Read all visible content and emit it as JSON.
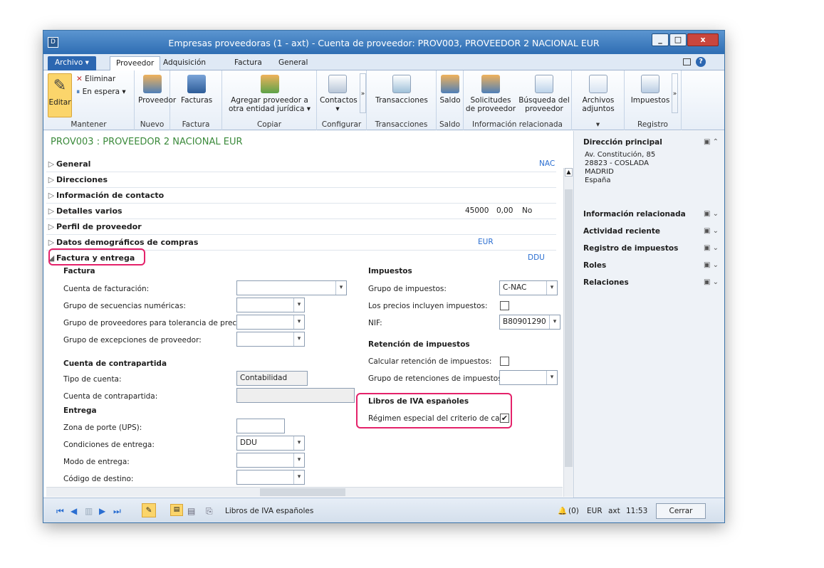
{
  "window": {
    "title": "Empresas proveedoras (1 - axt) - Cuenta de proveedor: PROV003, PROVEEDOR 2 NACIONAL EUR",
    "app_icon": "dynamics-ax-icon",
    "buttons": {
      "minimize": "_",
      "maximize": "□",
      "close": "x"
    }
  },
  "tabs": [
    {
      "label": "Archivo ▾"
    },
    {
      "label": "Proveedor"
    },
    {
      "label": "Adquisición"
    },
    {
      "label": "Factura"
    },
    {
      "label": "General"
    }
  ],
  "ribbon": {
    "mantener": {
      "label": "Mantener",
      "editar": "Editar",
      "eliminar": "Eliminar",
      "en_espera": "En espera ▾"
    },
    "nuevo": {
      "label": "Nuevo",
      "proveedor": "Proveedor"
    },
    "factura": {
      "label": "Factura",
      "facturas": "Facturas"
    },
    "copiar": {
      "label": "Copiar",
      "agregar": "Agregar proveedor a otra entidad jurídica ▾"
    },
    "configurar": {
      "label": "Configurar",
      "contactos": "Contactos ▾"
    },
    "transacciones": {
      "label": "Transacciones",
      "btn": "Transacciones"
    },
    "saldo": {
      "label": "Saldo",
      "btn": "Saldo"
    },
    "info": {
      "label": "Información relacionada",
      "solicitudes": "Solicitudes de proveedor",
      "busqueda": "Búsqueda del proveedor"
    },
    "archivos": {
      "label": "▾",
      "btn": "Archivos adjuntos"
    },
    "registro": {
      "label": "Registro",
      "impuestos": "Impuestos"
    }
  },
  "header": {
    "title": "PROV003 : PROVEEDOR 2 NACIONAL EUR"
  },
  "sections": [
    {
      "label": "General",
      "summary": "NAC"
    },
    {
      "label": "Direcciones"
    },
    {
      "label": "Información de contacto"
    },
    {
      "label": "Detalles varios",
      "summary": [
        "45000",
        "0,00",
        "No"
      ]
    },
    {
      "label": "Perfil de proveedor"
    },
    {
      "label": "Datos demográficos de compras",
      "summary": "EUR"
    },
    {
      "label": "Factura y entrega",
      "summary": "DDU"
    }
  ],
  "factura": {
    "heading": "Factura",
    "cuenta_facturacion": "Cuenta de facturación:",
    "grupo_secuencias": "Grupo de secuencias numéricas:",
    "grupo_tolerancia": "Grupo de proveedores para tolerancia de precios:",
    "grupo_excepciones": "Grupo de excepciones de proveedor:",
    "contrapartida_heading": "Cuenta de contrapartida",
    "tipo_cuenta": "Tipo de cuenta:",
    "tipo_cuenta_value": "Contabilidad",
    "cuenta_contrapartida": "Cuenta de contrapartida:",
    "entrega_heading": "Entrega",
    "zona_porte": "Zona de porte (UPS):",
    "condiciones": "Condiciones de entrega:",
    "condiciones_value": "DDU",
    "modo": "Modo de entrega:",
    "codigo_destino": "Código de destino:"
  },
  "impuestos": {
    "heading": "Impuestos",
    "grupo": "Grupo de impuestos:",
    "grupo_value": "C-NAC",
    "precios_incluyen": "Los precios incluyen impuestos:",
    "nif": "NIF:",
    "nif_value": "B80901290",
    "retencion_heading": "Retención de impuestos",
    "calcular": "Calcular retención de impuestos:",
    "grupo_retenciones": "Grupo de retenciones de impuestos:",
    "libros_heading": "Libros de IVA españoles",
    "regimen": "Régimen especial del criterio de caja:",
    "regimen_checked": true
  },
  "factbox": {
    "direccion_title": "Dirección principal",
    "direccion_lines": [
      "Av. Constitución, 85",
      "28823 - COSLADA",
      "MADRID",
      "España"
    ],
    "items": [
      "Información relacionada",
      "Actividad reciente",
      "Registro de impuestos",
      "Roles",
      "Relaciones"
    ]
  },
  "statusbar": {
    "message": "Libros de IVA españoles",
    "notifications": "(0)",
    "currency": "EUR",
    "company": "axt",
    "time": "11:53",
    "close": "Cerrar"
  },
  "colors": {
    "title_bar": "#2e6db3",
    "header_green": "#3b8a3b",
    "highlight": "#e4226a",
    "link_blue": "#2a6ed1"
  }
}
